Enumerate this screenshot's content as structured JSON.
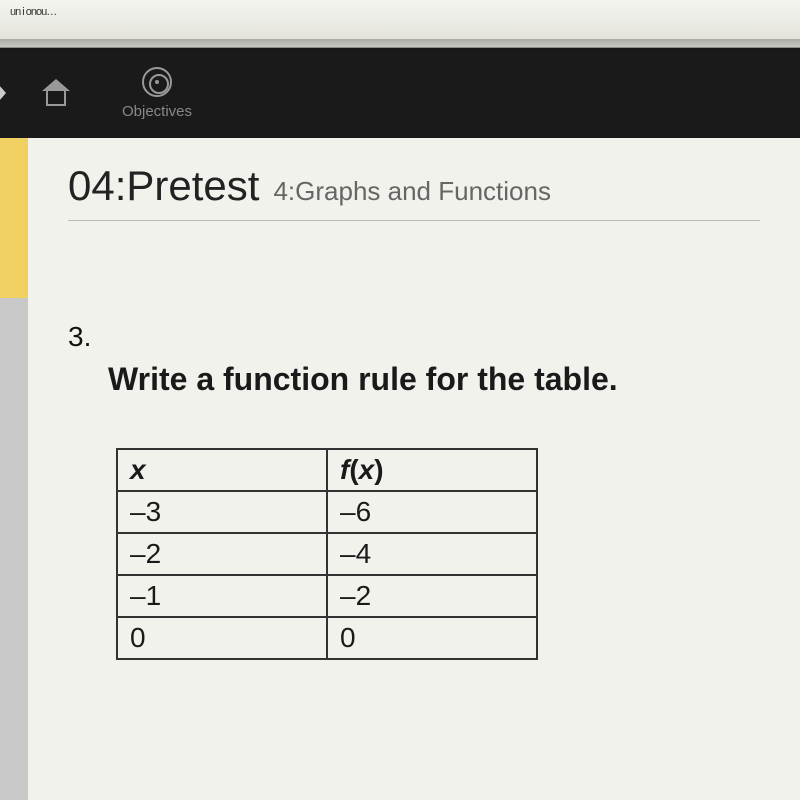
{
  "browser": {
    "partial_text": "un i onou…"
  },
  "nav": {
    "home_label": "",
    "objectives_label": "Objectives"
  },
  "header": {
    "title": "04:Pretest",
    "subtitle": "4:Graphs and Functions"
  },
  "question": {
    "number": "3.",
    "prompt": "Write a function rule for the table."
  },
  "table": {
    "headers": {
      "x": "x",
      "fx_f": "f",
      "fx_paren": "(",
      "fx_x": "x",
      "fx_close": ")"
    },
    "rows": [
      {
        "x": "–3",
        "fx": "–6"
      },
      {
        "x": "–2",
        "fx": "–4"
      },
      {
        "x": "–1",
        "fx": "–2"
      },
      {
        "x": "0",
        "fx": "0"
      }
    ]
  }
}
